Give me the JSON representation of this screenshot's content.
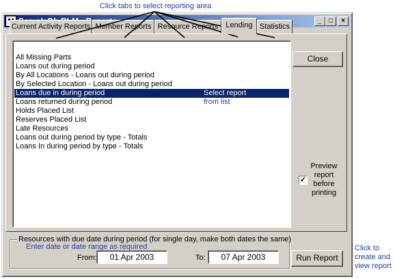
{
  "annotations": {
    "tabs": "Click tabs to select reporting area",
    "run": "Click to create and view report",
    "select": [
      "Select report",
      "from list"
    ]
  },
  "window": {
    "title": "SampleDb.RLM - Reports",
    "controls": {
      "minimize": "_",
      "maximize": "□",
      "close": "×"
    }
  },
  "tabs": [
    {
      "label": "Current Activity Reports",
      "active": false
    },
    {
      "label": "Member Reports",
      "active": false
    },
    {
      "label": "Resource Reports",
      "active": false
    },
    {
      "label": "Lending",
      "active": true
    },
    {
      "label": "Statistics",
      "active": false
    }
  ],
  "reports": [
    "All Missing Parts",
    "Loans out during period",
    "By All Locations - Loans out during period",
    "By Selected Location - Loans out during period",
    "Loans due in during period",
    "Loans returned during period",
    "Holds Placed List",
    "Reserves Placed List",
    "Late Resources",
    "Loans out during period by type - Totals",
    "Loans In during period by type - Totals"
  ],
  "selected_report_index": 4,
  "buttons": {
    "close": "Close",
    "run_report": "Run Report"
  },
  "preview": {
    "label": "Preview report before printing",
    "checked": true,
    "check_mark": "✓"
  },
  "date_range": {
    "legend": "Resources with due date during period (for single day, make both dates the same)",
    "hint": "Enter date or date range as required",
    "from_label": "From:",
    "from_value": "01 Apr 2003",
    "to_label": "To:",
    "to_value": "07 Apr 2003"
  }
}
